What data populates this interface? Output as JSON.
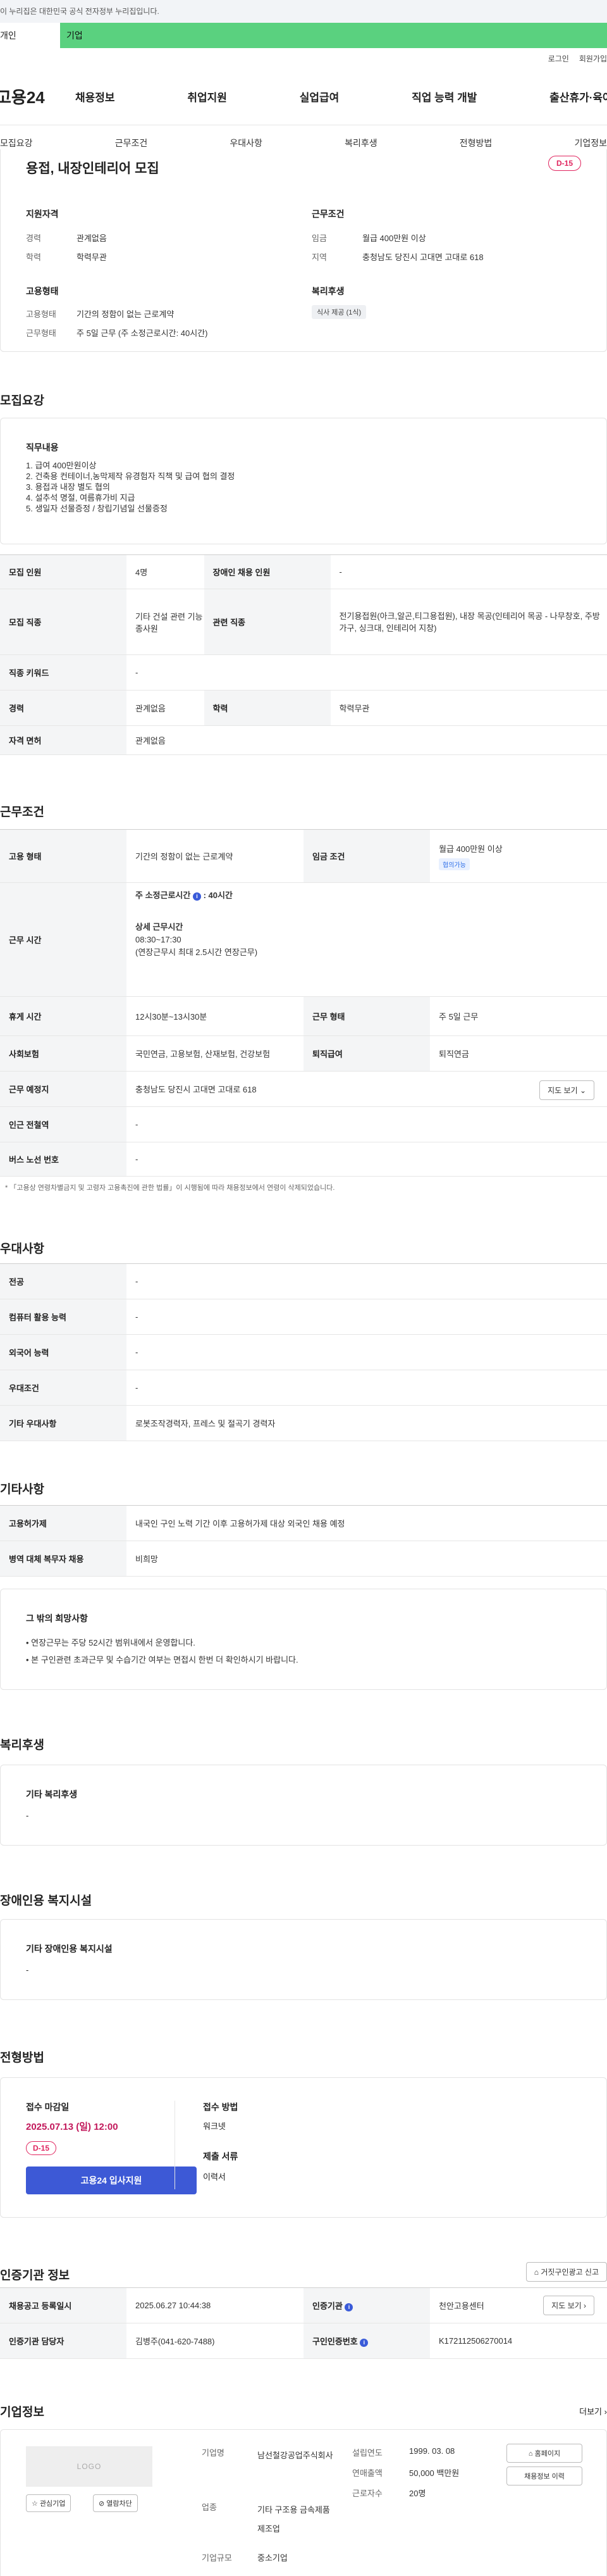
{
  "notice": "이 누리집은 대한민국 공식 전자정부 누리집입니다.",
  "top_tabs": [
    "개인",
    "기업"
  ],
  "util": [
    "로그인",
    "회원가입"
  ],
  "logo": "고용24",
  "gnb": [
    "채용정보",
    "취업지원",
    "실업급여",
    "직업 능력 개발",
    "출산휴가·육아휴직"
  ],
  "subnav": [
    "모집요강",
    "근무조건",
    "우대사항",
    "복리후생",
    "전형방법",
    "기업정보"
  ],
  "job": {
    "title": "용접, 내장인테리어 모집",
    "dday": "D-15",
    "qual_h": "지원자격",
    "cond_h": "근무조건",
    "career_l": "경력",
    "career_v": "관계없음",
    "edu_l": "학력",
    "edu_v": "학력무관",
    "wage_l": "임금",
    "wage_v": "월급 400만원 이상",
    "area_l": "지역",
    "area_v": "충청남도 당진시 고대면 고대로 618",
    "emp_h": "고용형태",
    "welfare_h": "복리후생",
    "emptype_l": "고용형태",
    "emptype_v": "기간의 정함이 없는 근로계약",
    "worktype_l": "근무형태",
    "worktype_v": "주 5일 근무 (주 소정근로시간: 40시간)",
    "welfare_pill": "식사 제공 (1식)"
  },
  "recruit": {
    "title": "모집요강",
    "duty_h": "직무내용",
    "duties": [
      "1. 급여 400만원이상",
      "2. 건축용 컨테이너,농막제작 유경험자 직책 및 급여 협의 결정",
      "3. 용접과 내장 별도 협의",
      "4. 설추석 명절, 여름휴가비 지급",
      "5. 생일자 선물증정 / 창립기념일 선물증정"
    ],
    "rows": [
      {
        "k1": "모집 인원",
        "v1": "4명",
        "k2": "장애인 채용 인원",
        "v2": "-"
      },
      {
        "k1": "모집 직종",
        "v1": "기타 건설 관련 기능 종사원",
        "k2": "관련 직종",
        "v2": "전기용접원(아크,알곤,티그용접원), 내장 목공(인테리어 목공 - 나무창호, 주방가구, 싱크대, 인테리어 지창)"
      },
      {
        "k1": "직종 키워드",
        "v1": "-"
      },
      {
        "k1": "경력",
        "v1": "관계없음",
        "k2": "학력",
        "v2": "학력무관"
      },
      {
        "k1": "자격 면허",
        "v1": "관계없음"
      }
    ]
  },
  "work": {
    "title": "근무조건",
    "emp_k": "고용 형태",
    "emp_v": "기간의 정함이 없는 근로계약",
    "wage_k": "임금 조건",
    "wage_v": "월급 400만원 이상",
    "wage_tag": "협의가능",
    "time_k": "근무 시간",
    "time_main": "주 소정근로시간",
    "time_hours": "40시간",
    "time_detail_h": "상세 근무시간",
    "time_detail": "08:30~17:30",
    "time_extra": "(연장근무시 최대 2.5시간 연장근무)",
    "break_k": "휴게 시간",
    "break_v": "12시30분~13시30분",
    "form_k": "근무 형태",
    "form_v": "주 5일 근무",
    "ins_k": "사회보험",
    "ins_v": "국민연금, 고용보험, 산재보험, 건강보험",
    "ret_k": "퇴직급여",
    "ret_v": "퇴직연금",
    "place_k": "근무 예정지",
    "place_v": "충청남도 당진시 고대면 고대로 618",
    "map_btn": "지도 보기",
    "sub_k": "인근 전철역",
    "sub_v": "-",
    "bus_k": "버스 노선 번호",
    "bus_v": "-",
    "footnote": "* 「고용상 연령차별금지 및 고령자 고용촉진에 관한 법률」이 시행됨에 따라 채용정보에서 연령이 삭제되었습니다."
  },
  "pref": {
    "title": "우대사항",
    "rows": [
      [
        "전공",
        "-"
      ],
      [
        "컴퓨터 활용 능력",
        "-"
      ],
      [
        "외국어 능력",
        "-"
      ],
      [
        "우대조건",
        "-"
      ],
      [
        "기타 우대사항",
        "로봇조작경력자, 프레스 및 절곡기 경력자"
      ]
    ]
  },
  "etc": {
    "title": "기타사항",
    "rows": [
      [
        "고용허가제",
        "내국인 구인 노력 기간 이후 고용허가제 대상 외국인 채용 예정"
      ],
      [
        "병역 대체 복무자 채용",
        "비희망"
      ]
    ],
    "box_h": "그 밖의 희망사항",
    "box_items": [
      "• 연장근무는 주당 52시간 범위내에서 운영합니다.",
      "• 본 구인관련 초과근무 및 수습기간 여부는 면접시 한번 더 확인하시기 바랍니다."
    ]
  },
  "welfare": {
    "title": "복리후생",
    "box_h": "기타 복리후생",
    "box_v": "-"
  },
  "disabled": {
    "title": "장애인용 복지시설",
    "box_h": "기타 장애인용 복지시설",
    "box_v": "-"
  },
  "process": {
    "title": "전형방법",
    "deadline_h": "접수 마감일",
    "deadline": "2025.07.13 (일) 12:00",
    "dday": "D-15",
    "apply_btn": "고용24 입사지원",
    "method_h": "접수 방법",
    "method_v": "워크넷",
    "docs_h": "제출 서류",
    "docs_v": "이력서"
  },
  "cert": {
    "title": "인증기관 정보",
    "report_btn": "거짓구인광고 신고",
    "reg_k": "채용공고 등록일시",
    "reg_v": "2025.06.27 10:44:38",
    "org_k": "인증기관",
    "org_v": "천안고용센터",
    "map_btn": "지도 보기",
    "mgr_k": "인증기관 담당자",
    "mgr_v": "김병주(041-620-7488)",
    "no_k": "구인인증번호",
    "no_v": "K172112506270014"
  },
  "company": {
    "title": "기업정보",
    "more": "더보기",
    "logo": "LOGO",
    "fav_btn": "관심기업",
    "block_btn": "열람차단",
    "name_k": "기업명",
    "name_v": "남선철강공업주식회사",
    "biz_k": "업종",
    "biz_v": "기타 구조용 금속제품 제조업",
    "size_k": "기업규모",
    "size_v": "중소기업",
    "est_k": "설립연도",
    "est_v": "1999. 03. 08",
    "sales_k": "연매출액",
    "sales_v": "50,000 백만원",
    "emp_k": "근로자수",
    "emp_v": "20명",
    "home_btn": "홈페이지",
    "jobs_btn": "채용정보 이력"
  }
}
